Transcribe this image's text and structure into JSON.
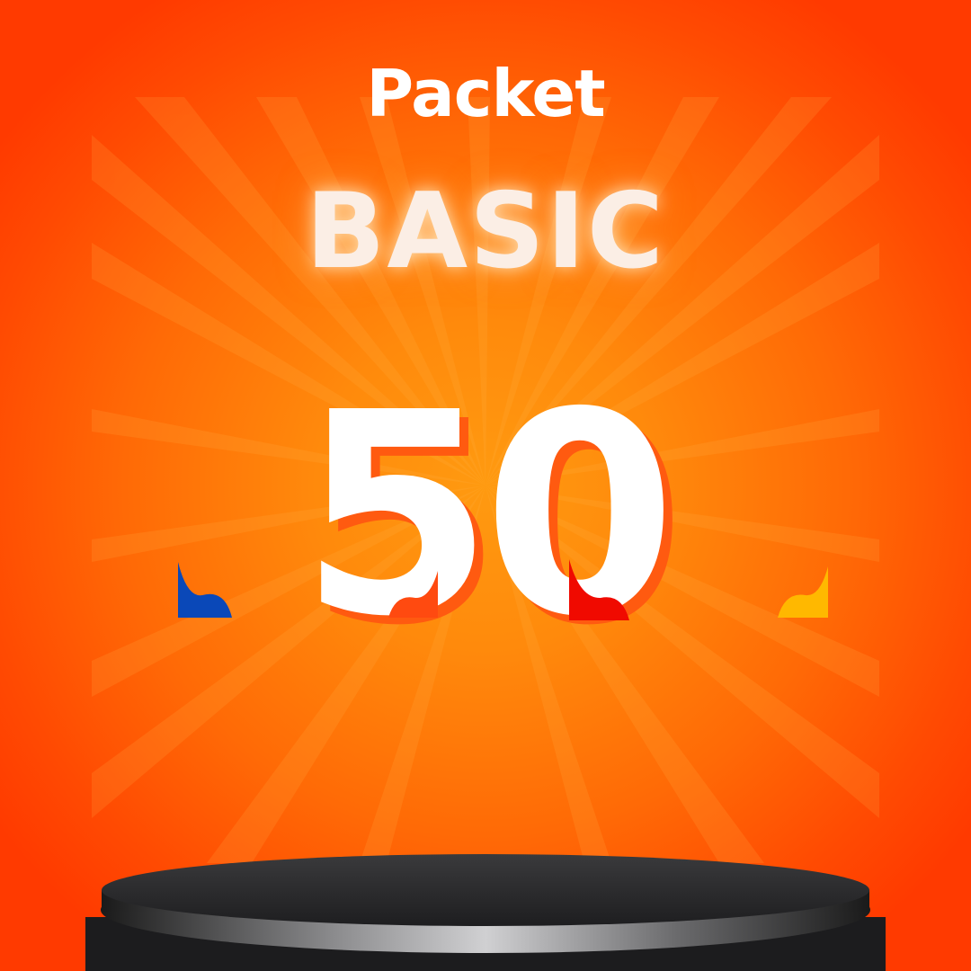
{
  "header": {
    "label": "Packet",
    "plan": "BASIC"
  },
  "amount": {
    "value": "50"
  },
  "icons": {
    "rays": "sunburst-rays-icon",
    "left_swoosh": "blue-swoosh-icon",
    "mid_swoosh": "orange-swoosh-icon",
    "right_mark": "red-swoosh-icon",
    "far_right_swoosh": "yellow-swoosh-icon",
    "podium": "podium-icon"
  },
  "colors": {
    "background": "#ff6a06",
    "title": "#ffffff",
    "plan_text": "#fbeee5",
    "number_fill": "#ffffff",
    "number_shadow": "#ff5a10",
    "swoosh_blue": "#0a48b8",
    "swoosh_orange": "#ff4a10",
    "swoosh_red": "#f00a00",
    "swoosh_yellow": "#ffb800",
    "podium": "#2c2c2e"
  }
}
